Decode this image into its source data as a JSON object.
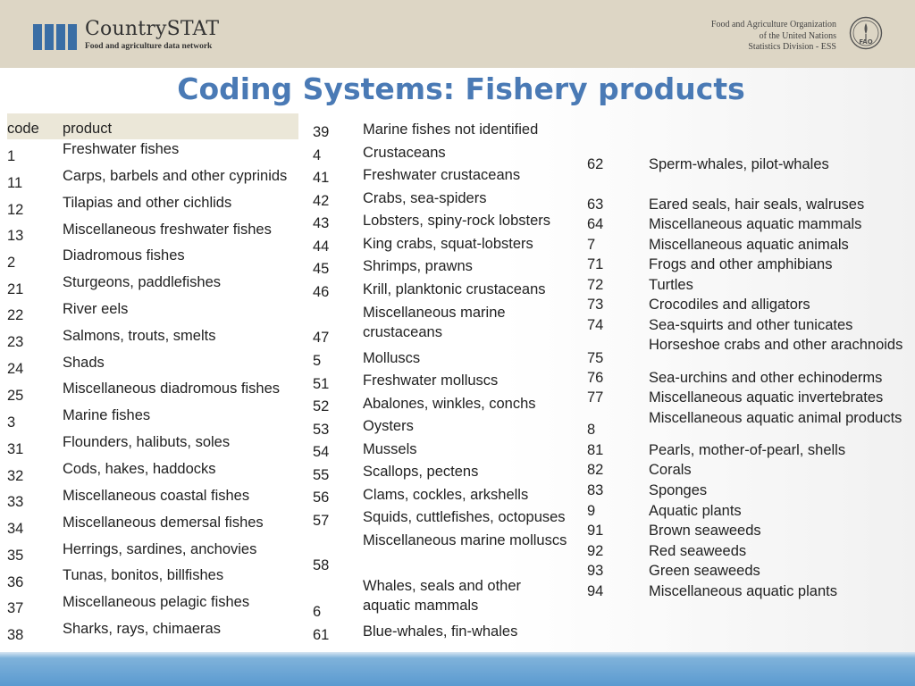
{
  "header": {
    "logo_title": "CountrySTAT",
    "logo_subtitle": "Food and agriculture data network",
    "org_lines": [
      "Food and Agriculture Organization",
      "of the United Nations",
      "Statistics Division - ESS"
    ],
    "emblem_text": "FAO"
  },
  "page_title": "Coding Systems: Fishery products",
  "table": {
    "headers": {
      "code": "code",
      "product": "product"
    },
    "column1": [
      {
        "code": "1",
        "product": "Freshwater fishes"
      },
      {
        "code": "11",
        "product": "Carps, barbels and other cyprinids"
      },
      {
        "code": "12",
        "product": "Tilapias and other cichlids"
      },
      {
        "code": "13",
        "product": "Miscellaneous freshwater fishes"
      },
      {
        "code": "2",
        "product": "Diadromous fishes"
      },
      {
        "code": "21",
        "product": "Sturgeons, paddlefishes"
      },
      {
        "code": "22",
        "product": "River eels"
      },
      {
        "code": "23",
        "product": "Salmons, trouts, smelts"
      },
      {
        "code": "24",
        "product": "Shads"
      },
      {
        "code": "25",
        "product": "Miscellaneous diadromous fishes"
      },
      {
        "code": "3",
        "product": "Marine fishes"
      },
      {
        "code": "31",
        "product": "Flounders, halibuts, soles"
      },
      {
        "code": "32",
        "product": "Cods, hakes, haddocks"
      },
      {
        "code": "33",
        "product": "Miscellaneous coastal fishes"
      },
      {
        "code": "34",
        "product": "Miscellaneous demersal fishes"
      },
      {
        "code": "35",
        "product": "Herrings, sardines, anchovies"
      },
      {
        "code": "36",
        "product": "Tunas, bonitos, billfishes"
      },
      {
        "code": "37",
        "product": "Miscellaneous pelagic fishes"
      },
      {
        "code": "38",
        "product": "Sharks, rays, chimaeras"
      }
    ],
    "column2": [
      {
        "code": "39",
        "product": "Marine fishes not identified"
      },
      {
        "code": "4",
        "product": "Crustaceans"
      },
      {
        "code": "41",
        "product": "Freshwater crustaceans"
      },
      {
        "code": "42",
        "product": "Crabs, sea-spiders"
      },
      {
        "code": "43",
        "product": "Lobsters, spiny-rock lobsters"
      },
      {
        "code": "44",
        "product": "King crabs, squat-lobsters"
      },
      {
        "code": "45",
        "product": "Shrimps, prawns"
      },
      {
        "code": "46",
        "product": "Krill, planktonic crustaceans"
      },
      {
        "code": "47",
        "product": "Miscellaneous marine crustaceans"
      },
      {
        "code": "5",
        "product": "Molluscs"
      },
      {
        "code": "51",
        "product": "Freshwater molluscs"
      },
      {
        "code": "52",
        "product": "Abalones, winkles, conchs"
      },
      {
        "code": "53",
        "product": "Oysters"
      },
      {
        "code": "54",
        "product": "Mussels"
      },
      {
        "code": "55",
        "product": "Scallops, pectens"
      },
      {
        "code": "56",
        "product": "Clams, cockles, arkshells"
      },
      {
        "code": "57",
        "product": "Squids, cuttlefishes, octopuses"
      },
      {
        "code": "58",
        "product": "Miscellaneous marine molluscs"
      },
      {
        "code": "6",
        "product": "Whales, seals and other aquatic mammals"
      },
      {
        "code": "61",
        "product": "Blue-whales, fin-whales"
      }
    ],
    "column3": [
      {
        "code": "62",
        "product": "Sperm-whales, pilot-whales"
      },
      {
        "code": "63",
        "product": "Eared seals, hair seals, walruses"
      },
      {
        "code": "64",
        "product": "Miscellaneous aquatic mammals"
      },
      {
        "code": "7",
        "product": "Miscellaneous aquatic animals"
      },
      {
        "code": "71",
        "product": "Frogs and other amphibians"
      },
      {
        "code": "72",
        "product": "Turtles"
      },
      {
        "code": "73",
        "product": "Crocodiles and alligators"
      },
      {
        "code": "74",
        "product": "Sea-squirts and other tunicates"
      },
      {
        "code": "75",
        "product": "Horseshoe crabs and other arachnoids"
      },
      {
        "code": "76",
        "product": "Sea-urchins and other echinoderms"
      },
      {
        "code": "77",
        "product": "Miscellaneous aquatic invertebrates"
      },
      {
        "code": "8",
        "product": "Miscellaneous aquatic animal products"
      },
      {
        "code": "81",
        "product": "Pearls, mother-of-pearl, shells"
      },
      {
        "code": "82",
        "product": "Corals"
      },
      {
        "code": "83",
        "product": "Sponges"
      },
      {
        "code": "9",
        "product": "Aquatic plants"
      },
      {
        "code": "91",
        "product": "Brown seaweeds"
      },
      {
        "code": "92",
        "product": "Red seaweeds"
      },
      {
        "code": "93",
        "product": "Green seaweeds"
      },
      {
        "code": "94",
        "product": "Miscellaneous aquatic plants"
      }
    ]
  },
  "colors": {
    "header_bg": "#ddd6c5",
    "title": "#4a7ab5",
    "logo_bars": "#3a6ea5",
    "footer": "#5a9ad0",
    "table_header_bg": "#ebe7d8"
  }
}
